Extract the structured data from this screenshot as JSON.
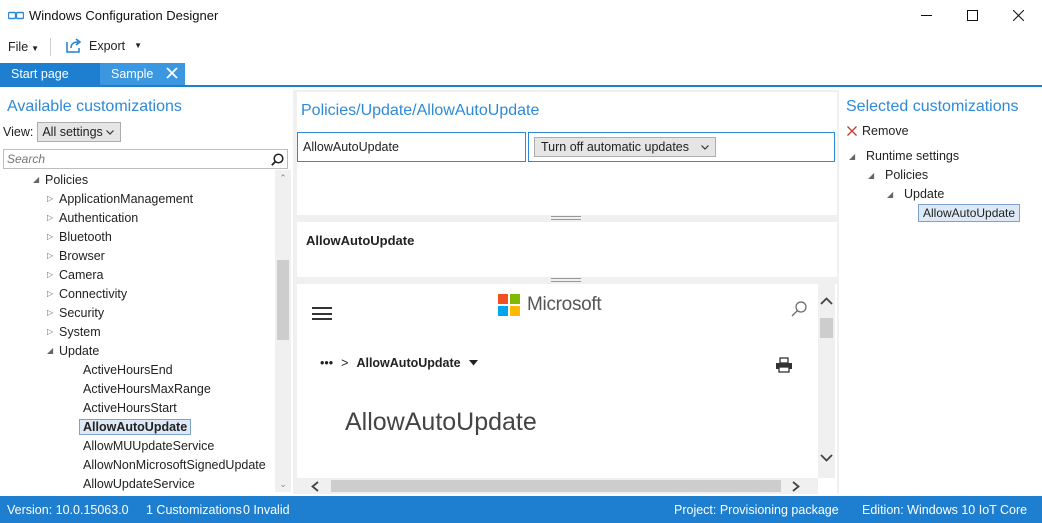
{
  "window": {
    "title": "Windows Configuration Designer"
  },
  "menu": {
    "file_label": "File",
    "export_label": "Export"
  },
  "tabs": [
    {
      "label": "Start page"
    },
    {
      "label": "Sample"
    }
  ],
  "left_panel": {
    "heading": "Available customizations",
    "view_label": "View:",
    "view_value": "All settings",
    "search_placeholder": "Search",
    "tree": [
      {
        "label": "Policies",
        "expanded": true
      },
      {
        "label": "ApplicationManagement"
      },
      {
        "label": "Authentication"
      },
      {
        "label": "Bluetooth"
      },
      {
        "label": "Browser"
      },
      {
        "label": "Camera"
      },
      {
        "label": "Connectivity"
      },
      {
        "label": "Security"
      },
      {
        "label": "System"
      },
      {
        "label": "Update",
        "expanded": true
      },
      {
        "label": "ActiveHoursEnd"
      },
      {
        "label": "ActiveHoursMaxRange"
      },
      {
        "label": "ActiveHoursStart"
      },
      {
        "label": "AllowAutoUpdate",
        "selected": true
      },
      {
        "label": "AllowMUUpdateService"
      },
      {
        "label": "AllowNonMicrosoftSignedUpdate"
      },
      {
        "label": "AllowUpdateService"
      }
    ]
  },
  "center_panel": {
    "heading": "Policies/Update/AllowAutoUpdate",
    "setting_name": "AllowAutoUpdate",
    "setting_value": "Turn off automatic updates",
    "description_title": "AllowAutoUpdate",
    "doc": {
      "brand": "Microsoft",
      "breadcrumb_more": "•••",
      "breadcrumb_sep": ">",
      "breadcrumb_current": "AllowAutoUpdate",
      "title": "AllowAutoUpdate"
    }
  },
  "right_panel": {
    "heading": "Selected customizations",
    "remove_label": "Remove",
    "tree": [
      {
        "label": "Runtime settings"
      },
      {
        "label": "Policies"
      },
      {
        "label": "Update"
      },
      {
        "label": "AllowAutoUpdate",
        "selected": true
      }
    ]
  },
  "status": {
    "version": "Version: 10.0.15063.0",
    "customizations": "1 Customizations",
    "invalid": "0 Invalid",
    "project": "Project: Provisioning package",
    "edition": "Edition: Windows 10 IoT Core"
  },
  "colors": {
    "accent": "#1e7fd0",
    "tab_active": "#3a97e0",
    "heading": "#2e8ad8",
    "ms_red": "#f25022",
    "ms_green": "#7fba00",
    "ms_blue": "#00a4ef",
    "ms_yellow": "#ffb900"
  }
}
